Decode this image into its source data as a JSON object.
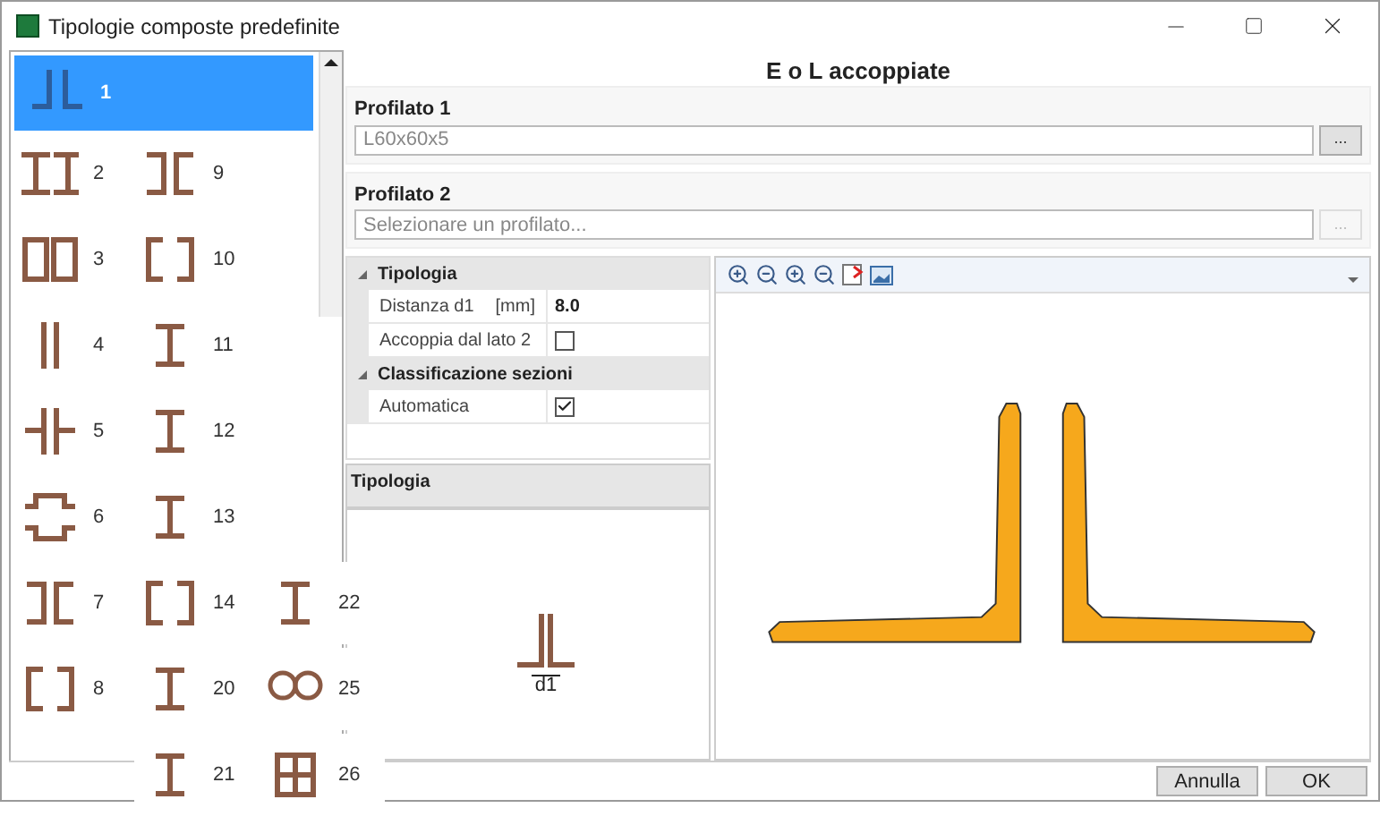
{
  "window": {
    "title": "Tipologie composte predefinite"
  },
  "typologies": [
    {
      "label": "1",
      "selected": true
    },
    {
      "label": "2",
      "selected": false
    },
    {
      "label": "9",
      "selected": false
    },
    {
      "label": "3",
      "selected": false
    },
    {
      "label": "10",
      "selected": false
    },
    {
      "label": "4",
      "selected": false
    },
    {
      "label": "11",
      "selected": false
    },
    {
      "label": "5",
      "selected": false
    },
    {
      "label": "12",
      "selected": false
    },
    {
      "label": "6",
      "selected": false
    },
    {
      "label": "13",
      "selected": false
    },
    {
      "label": "7",
      "selected": false
    },
    {
      "label": "14",
      "selected": false
    },
    {
      "label": "22",
      "selected": false
    },
    {
      "label": "8",
      "selected": false
    },
    {
      "label": "20",
      "selected": false
    },
    {
      "label": "25",
      "selected": false
    },
    {
      "label": "21",
      "selected": false
    },
    {
      "label": "26",
      "selected": false
    }
  ],
  "heading": "E o L accoppiate",
  "profiles": [
    {
      "label": "Profilato 1",
      "value": "L60x60x5",
      "browse": "...",
      "disabled": false
    },
    {
      "label": "Profilato 2",
      "placeholder": "Selezionare un profilato...",
      "browse": "...",
      "disabled": true
    }
  ],
  "properties": [
    {
      "category": "Tipologia",
      "expanded": true,
      "rows": [
        {
          "kind": "value",
          "name": "Distanza d1",
          "unit": "[mm]",
          "value": "8.0"
        },
        {
          "kind": "checkbox",
          "name": "Accoppia dal lato 2",
          "checked": false
        }
      ]
    },
    {
      "category": "Classificazione sezioni",
      "expanded": true,
      "rows": [
        {
          "kind": "checkbox",
          "name": "Automatica",
          "checked": true
        }
      ]
    }
  ],
  "description": {
    "title": "Tipologia"
  },
  "preview": {
    "dimension": "d1"
  },
  "buttons": [
    "Annulla",
    "OK"
  ]
}
